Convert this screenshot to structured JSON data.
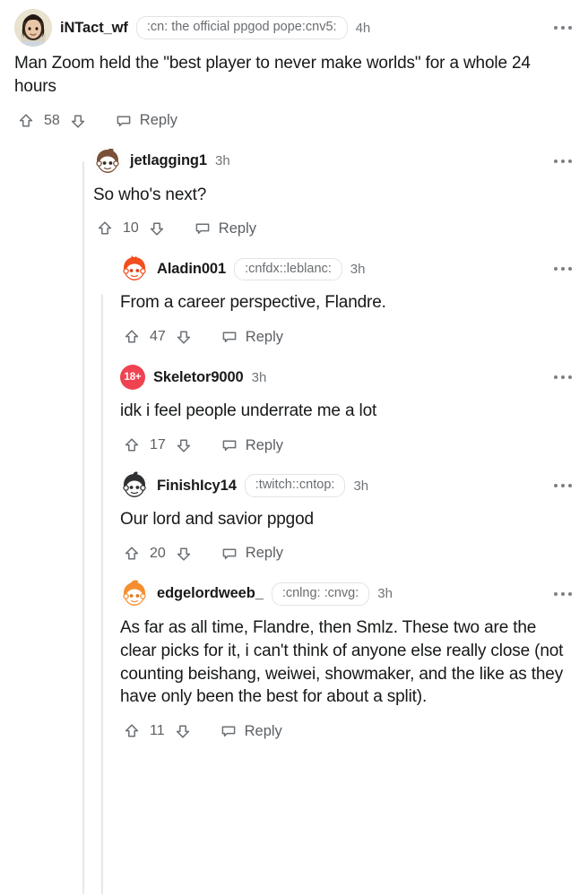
{
  "app": {
    "platform": "reddit-comment-thread"
  },
  "icons": {
    "upvote": "upvote-arrow-icon",
    "downvote": "downvote-arrow-icon",
    "reply": "comment-bubble-icon",
    "overflow": "more-options-icon",
    "nsfw": "nsfw-18-plus-icon"
  },
  "colors": {
    "nsfw_badge": "#f04352",
    "text": "#16181a",
    "muted": "#70757a",
    "rail": "#e6e7e8",
    "flair_border": "#e2e3e4"
  },
  "labels": {
    "reply": "Reply",
    "nsfw_badge": "18+"
  },
  "comments": [
    {
      "id": "c0",
      "depth": 0,
      "username": "iNTact_wf",
      "avatar_type": "photo",
      "flair": ":cn: the official ppgod pope:cnv5:",
      "age": "4h",
      "body": "Man Zoom held the \"best player to never make worlds\" for a whole 24 hours",
      "score": "58",
      "nsfw": false
    },
    {
      "id": "c1",
      "depth": 1,
      "username": "jetlagging1",
      "avatar_type": "snoo-brown",
      "flair": "",
      "age": "3h",
      "body": "So who's next?",
      "score": "10",
      "nsfw": false
    },
    {
      "id": "c2",
      "depth": 2,
      "username": "Aladin001",
      "avatar_type": "snoo-orangered",
      "flair": ":cnfdx::leblanc:",
      "age": "3h",
      "body": "From a career perspective, Flandre.",
      "score": "47",
      "nsfw": false
    },
    {
      "id": "c3",
      "depth": 2,
      "username": "Skeletor9000",
      "avatar_type": "nsfw-badge",
      "flair": "",
      "age": "3h",
      "body": "idk i feel people underrate me a lot",
      "score": "17",
      "nsfw": true
    },
    {
      "id": "c4",
      "depth": 2,
      "username": "FinishIcy14",
      "avatar_type": "snoo-dark",
      "flair": ":twitch::cntop:",
      "age": "3h",
      "body": "Our lord and savior ppgod",
      "score": "20",
      "nsfw": false
    },
    {
      "id": "c5",
      "depth": 2,
      "username": "edgelordweeb_",
      "avatar_type": "snoo-orange",
      "flair": ":cnlng: :cnvg:",
      "age": "3h",
      "body": "As far as all time, Flandre, then Smlz. These two are the clear picks for it, i can't think of anyone else really close (not counting beishang, weiwei, showmaker, and the like as they have only been the best for about a split).",
      "score": "11",
      "nsfw": false
    }
  ]
}
